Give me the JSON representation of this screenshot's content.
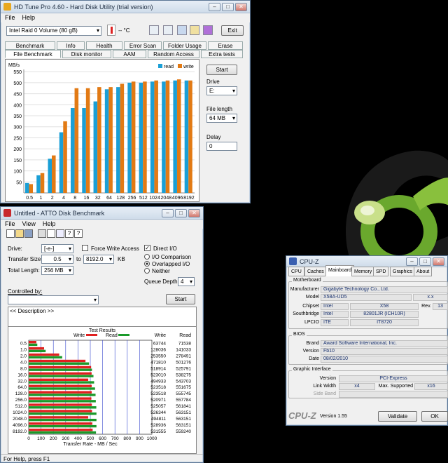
{
  "hdtune": {
    "title": "HD Tune Pro 4.60 - Hard Disk Utility (trial version)",
    "menu": [
      "File",
      "Help"
    ],
    "drive_select": "Intel  Raid 0 Volume (80 gB)",
    "temp": "-- °C",
    "exit_label": "Exit",
    "tabs_top": [
      "Benchmark",
      "Info",
      "Health",
      "Error Scan",
      "Folder Usage",
      "Erase"
    ],
    "tabs_bottom": [
      "File Benchmark",
      "Disk monitor",
      "AAM",
      "Random Access",
      "Extra tests"
    ],
    "start_label": "Start",
    "drive_label": "Drive",
    "drive_value": "E:",
    "file_length_label": "File length",
    "file_length_value": "64 MB",
    "delay_label": "Delay",
    "delay_value": "0",
    "unit": "MB/s",
    "legend_read": "read",
    "legend_write": "write"
  },
  "chart_data": [
    {
      "type": "bar",
      "unit": "MB/s",
      "categories": [
        "0.5",
        "1",
        "2",
        "4",
        "8",
        "16",
        "32",
        "64",
        "128",
        "256",
        "512",
        "1024",
        "2048",
        "4096",
        "8192"
      ],
      "series": [
        {
          "name": "read",
          "color": "#1a9fd6",
          "values": [
            45,
            80,
            155,
            275,
            385,
            385,
            415,
            470,
            480,
            500,
            500,
            505,
            505,
            510,
            510
          ]
        },
        {
          "name": "write",
          "color": "#e27a14",
          "values": [
            40,
            90,
            170,
            325,
            475,
            475,
            480,
            480,
            495,
            505,
            505,
            510,
            510,
            515,
            510
          ]
        }
      ],
      "ylim": [
        0,
        560
      ],
      "yticks": [
        50,
        100,
        150,
        200,
        250,
        300,
        350,
        400,
        450,
        500,
        550
      ],
      "xtick_labels": [
        "0.5",
        "1",
        "2",
        "4",
        "8",
        "16",
        "32",
        "64",
        "128",
        "256",
        "512",
        "1024",
        "2048",
        "4096",
        "8192"
      ]
    },
    {
      "type": "bar",
      "orientation": "horizontal",
      "title": "Test Results",
      "xlabel": "Transfer Rate - MB / Sec",
      "xlim": [
        0,
        1000
      ],
      "xticks": [
        "0",
        "100",
        "200",
        "300",
        "400",
        "500",
        "600",
        "700",
        "800",
        "900",
        "1000"
      ],
      "categories": [
        "0.5",
        "1.0",
        "2.0",
        "4.0",
        "8.0",
        "16.0",
        "32.0",
        "64.0",
        "128.0",
        "256.0",
        "512.0",
        "1024.0",
        "2048.0",
        "4096.0",
        "8192.0"
      ],
      "series": [
        {
          "name": "Write",
          "color": "#e02020",
          "values": [
            63744,
            128036,
            253550,
            471810,
            518914,
            523010,
            494933,
            523518,
            523518,
            520971,
            525057,
            526344,
            494811,
            528936,
            531555
          ]
        },
        {
          "name": "Read",
          "color": "#1a9a2a",
          "values": [
            71538,
            141033,
            278491,
            501276,
            525791,
            538275,
            543703,
            551675,
            555745,
            557784,
            561841,
            563151,
            563151,
            563151,
            559240
          ]
        }
      ]
    }
  ],
  "atto": {
    "title": "Untitled - ATTO Disk Benchmark",
    "menu": [
      "File",
      "View",
      "Help"
    ],
    "drive_label": "Drive:",
    "drive_value": "[-e-]",
    "force_write": "Force Write Access",
    "direct_io": "Direct I/O",
    "transfer_label": "Transfer Size:",
    "transfer_from": "0.5",
    "to_label": "to",
    "transfer_to": "8192.0",
    "kb": "KB",
    "total_label": "Total Length:",
    "total_value": "256 MB",
    "io_comparison": "I/O Comparison",
    "overlapped": "Overlapped I/O",
    "neither": "Neither",
    "queue_label": "Queue Depth:",
    "queue_value": "4",
    "controlled_by": "Controlled by:",
    "start_label": "Start",
    "description": "<< Description >>",
    "results_title": "Test Results",
    "write_label": "Write",
    "read_label": "Read",
    "col_write": "Write",
    "col_read": "Read",
    "xlabel": "Transfer Rate - MB / Sec",
    "status": "For Help, press F1"
  },
  "cpuz": {
    "title": "CPU-Z",
    "tabs": [
      "CPU",
      "Caches",
      "Mainboard",
      "Memory",
      "SPD",
      "Graphics",
      "About"
    ],
    "motherboard_group": "Motherboard",
    "manufacturer_label": "Manufacturer",
    "manufacturer": "Gigabyte Technology Co., Ltd.",
    "model_label": "Model",
    "model": "X58A-UD5",
    "model_rev": "x.x",
    "chipset_label": "Chipset",
    "chipset_vendor": "Intel",
    "chipset": "X58",
    "rev_label": "Rev.",
    "rev": "13",
    "southbridge_label": "Southbridge",
    "southbridge_vendor": "Intel",
    "southbridge": "82801JR (ICH10R)",
    "lpcio_label": "LPCIO",
    "lpcio_vendor": "ITE",
    "lpcio": "IT8720",
    "bios_group": "BIOS",
    "brand_label": "Brand",
    "brand": "Award Software International, Inc.",
    "version_label": "Version",
    "bios_version": "Fb10",
    "date_label": "Date",
    "date": "08/02/2010",
    "graphic_group": "Graphic Interface",
    "gi_version_label": "Version",
    "gi_version": "PCI-Express",
    "link_width_label": "Link Width",
    "link_width": "x4",
    "max_supported_label": "Max. Supported",
    "max_supported": "x16",
    "side_band_label": "Side Band",
    "footer_logo": "CPU-Z",
    "footer_version": "Version 1.55",
    "validate_label": "Validate",
    "ok_label": "OK"
  }
}
